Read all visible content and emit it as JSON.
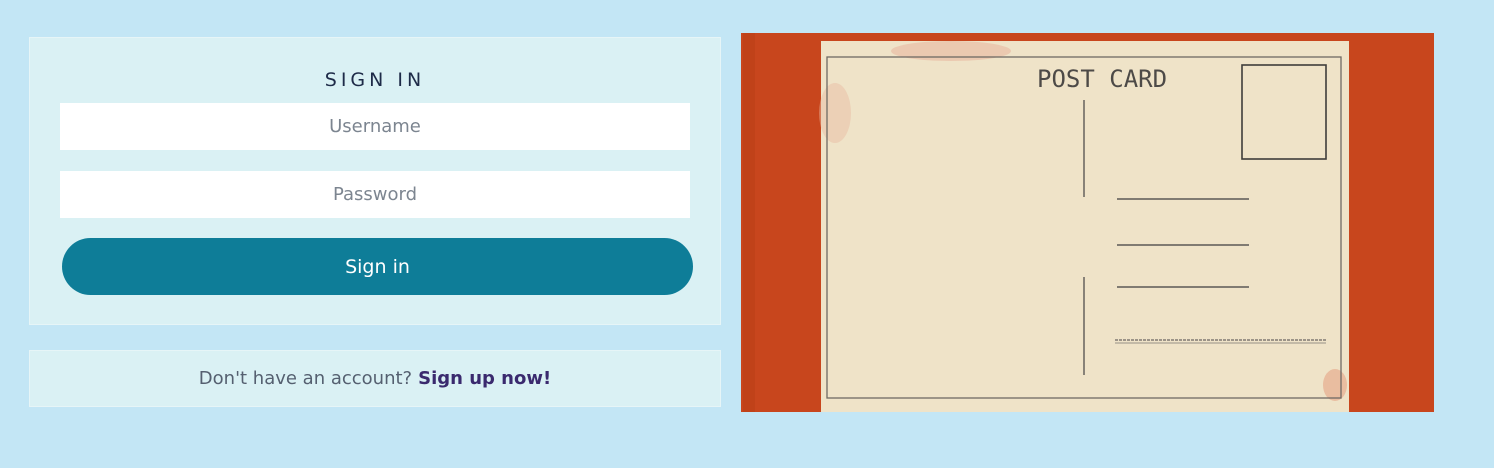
{
  "signin": {
    "title": "SIGN IN",
    "username_placeholder": "Username",
    "password_placeholder": "Password",
    "button_label": "Sign in"
  },
  "signup": {
    "prompt": "Don't have an account?",
    "link_label": "Sign up now!"
  },
  "image": {
    "postcard_text": "POST CARD"
  },
  "colors": {
    "page_background": "#c3e6f5",
    "card_background": "#daf1f4",
    "button": "#0e7d98",
    "link": "#3a2a6e",
    "image_backdrop": "#c8461d",
    "postcard_paper": "#efe3c8"
  }
}
